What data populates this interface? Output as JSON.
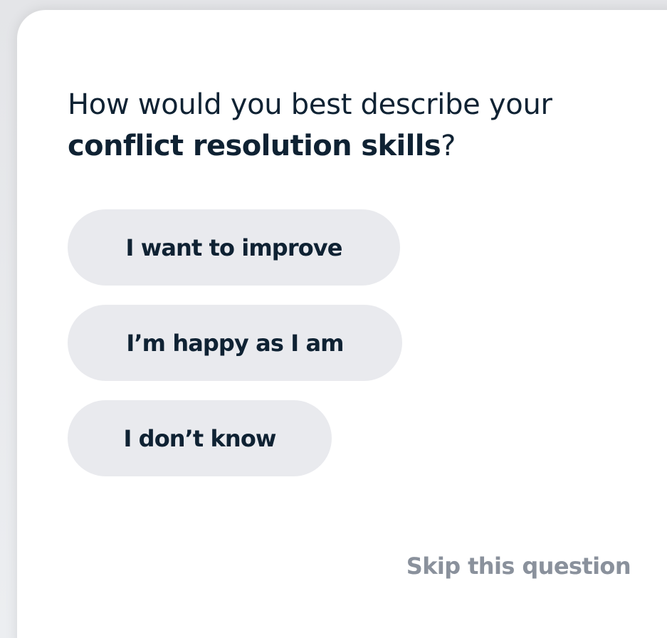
{
  "question": {
    "prefix": "How would you best describe your",
    "emphasis": "conflict resolution skills",
    "suffix": "?"
  },
  "options": [
    {
      "label": "I want to improve"
    },
    {
      "label": "I’m happy as I am"
    },
    {
      "label": "I don’t know"
    }
  ],
  "skip_label": "Skip this question",
  "colors": {
    "text_dark": "#0f2233",
    "option_bg": "#e9eaee",
    "skip_text": "#8a919c",
    "card_bg": "#ffffff",
    "page_bg": "#e9eaed"
  }
}
